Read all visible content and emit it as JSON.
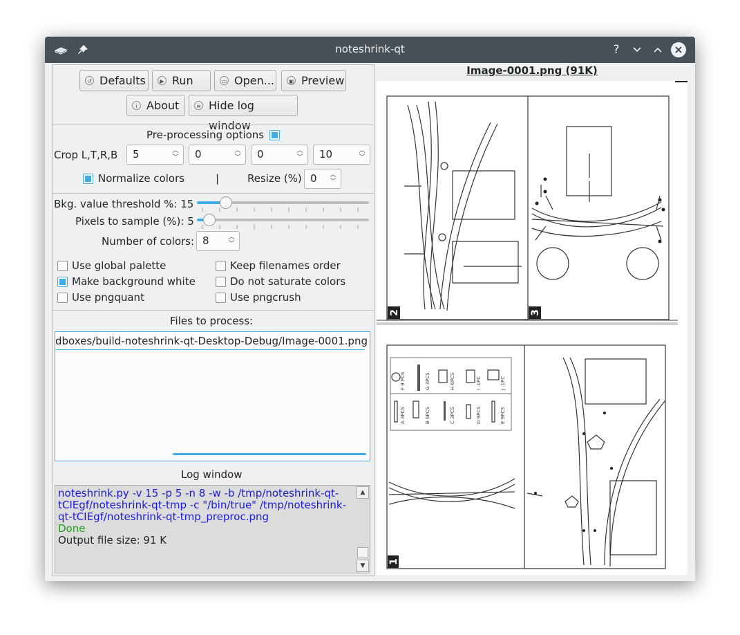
{
  "window": {
    "title": "noteshrink-qt"
  },
  "toolbar": {
    "defaults": "Defaults",
    "run": "Run",
    "open": "Open...",
    "preview": "Preview",
    "about": "About",
    "hide_log": "Hide log window"
  },
  "preprocessing": {
    "title": "Pre-processing options",
    "enabled": true,
    "crop_label": "Crop L,T,R,B",
    "crop_values": [
      "5",
      "0",
      "0",
      "10"
    ],
    "normalize_label": "Normalize colors",
    "normalize_checked": true,
    "separator": "|",
    "resize_label": "Resize (%)",
    "resize_value": "0"
  },
  "options": {
    "bkg_label": "Bkg. value threshold %: 15",
    "bkg_value": 15,
    "pixels_label": "Pixels to sample (%): 5",
    "pixels_value": 5,
    "colors_label": "Number of colors:",
    "colors_value": "8",
    "checkboxes": [
      {
        "label": "Use global palette",
        "checked": false
      },
      {
        "label": "Keep filenames order",
        "checked": false
      },
      {
        "label": "Make background white",
        "checked": true
      },
      {
        "label": "Do not saturate colors",
        "checked": false
      },
      {
        "label": "Use pngquant",
        "checked": false
      },
      {
        "label": "Use pngcrush",
        "checked": false
      }
    ]
  },
  "files": {
    "title": "Files to process:",
    "items": [
      "dboxes/build-noteshrink-qt-Desktop-Debug/Image-0001.png"
    ]
  },
  "log": {
    "title": "Log window",
    "command": "noteshrink.py -v 15 -p 5 -n 8 -w -b /tmp/noteshrink-qt-tCIEgf/noteshrink-qt-tmp -c \"/bin/true\" /tmp/noteshrink-qt-tCIEgf/noteshrink-qt-tmp_preproc.png",
    "done": "Done",
    "output": "Output file size: 91 K"
  },
  "preview": {
    "title": "Image-0001.png (91K)",
    "panel_numbers": [
      "2",
      "3",
      "1"
    ],
    "parts": [
      {
        "label": "F 9 PCS"
      },
      {
        "label": "G 3PCS"
      },
      {
        "label": "H 6PCS"
      },
      {
        "label": "I .1PC"
      },
      {
        "label": "J .1PC"
      },
      {
        "label": "A 3PCS"
      },
      {
        "label": "B 6PCS"
      },
      {
        "label": "C 3PCS"
      },
      {
        "label": "D 9PCS"
      },
      {
        "label": "E 9PCS"
      }
    ]
  },
  "colors": {
    "accent": "#3daee9",
    "titlebar": "#475057",
    "window_bg": "#eff0f1",
    "log_blue": "#1a1adb",
    "log_green": "#1e9e1e"
  }
}
